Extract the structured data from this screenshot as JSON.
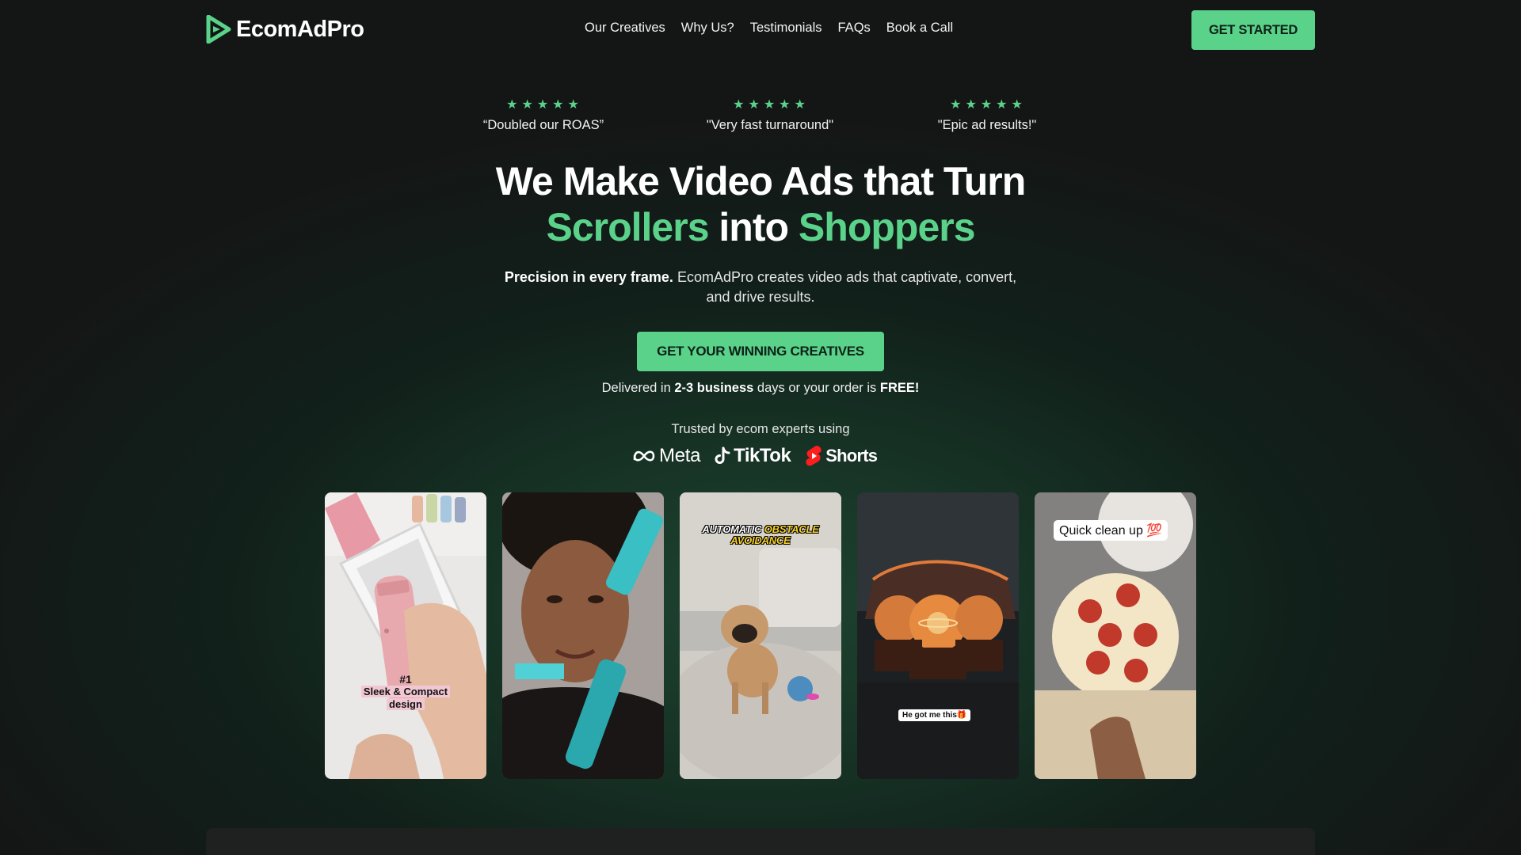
{
  "brand": {
    "name": "EcomAdPro",
    "accent": "#5bd28a",
    "background": "#141616"
  },
  "nav": {
    "links": [
      "Our Creatives",
      "Why Us?",
      "Testimonials",
      "FAQs",
      "Book a Call"
    ],
    "cta": "GET STARTED"
  },
  "reviews": [
    {
      "stars": 5,
      "quote": "“Doubled our ROAS”"
    },
    {
      "stars": 5,
      "quote": "\"Very fast turnaround\""
    },
    {
      "stars": 5,
      "quote": "\"Epic ad results!\""
    }
  ],
  "hero": {
    "headline_line1": "We Make Video Ads that Turn",
    "headline_word1": "Scrollers",
    "headline_mid": " into ",
    "headline_word2": "Shoppers",
    "sub_bold": "Precision in every frame.",
    "sub_rest": " EcomAdPro creates video ads that captivate, convert,",
    "sub_line2": "and drive results.",
    "cta": "GET YOUR WINNING CREATIVES",
    "delivered_a": "Delivered in ",
    "delivered_b": "2-3 business",
    "delivered_c": " days or your order is ",
    "delivered_d": "FREE!",
    "trusted": "Trusted by ecom experts using"
  },
  "platforms": [
    {
      "name": "Meta",
      "icon": "meta-infinity-icon"
    },
    {
      "name": "TikTok",
      "icon": "tiktok-note-icon"
    },
    {
      "name": "Shorts",
      "icon": "youtube-shorts-icon"
    }
  ],
  "videos": [
    {
      "caption_num": "#1",
      "caption": "Sleek & Compact design",
      "subject": "pink handheld device in box"
    },
    {
      "caption": "",
      "subject": "woman with teal gadget"
    },
    {
      "caption_a": "AUTOMATIC ",
      "caption_b": "OBSTACLE",
      "caption_c": "AVOIDANCE",
      "subject": "pug with ball"
    },
    {
      "caption": "He got me this🎁",
      "subject": "planet crystal ball lamps"
    },
    {
      "caption": "Quick clean up 💯",
      "subject": "pepperoni pizza on counter"
    }
  ]
}
